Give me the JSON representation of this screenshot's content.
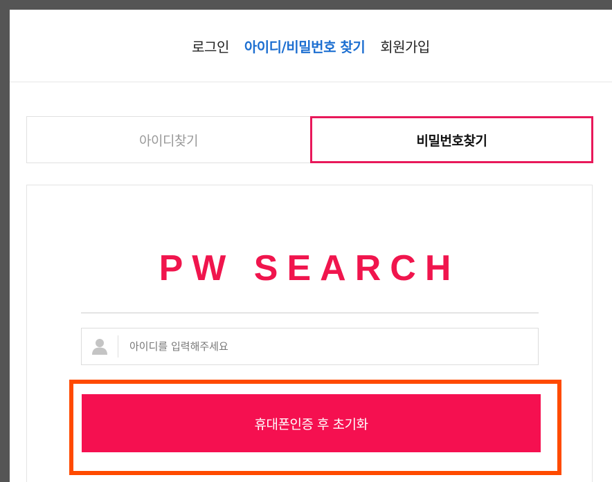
{
  "topnav": {
    "login": "로그인",
    "find_account": "아이디/비밀번호 찾기",
    "signup": "회원가입"
  },
  "tabs": {
    "find_id": "아이디찾기",
    "find_password": "비밀번호찾기"
  },
  "panel": {
    "brand": "PW SEARCH",
    "id_input": {
      "value": "",
      "placeholder": "아이디를 입력해주세요"
    },
    "submit_label": "휴대폰인증 후 초기화"
  },
  "colors": {
    "accent": "#f51050",
    "link_active": "#1d6fd1",
    "highlight": "#ff4a00"
  }
}
